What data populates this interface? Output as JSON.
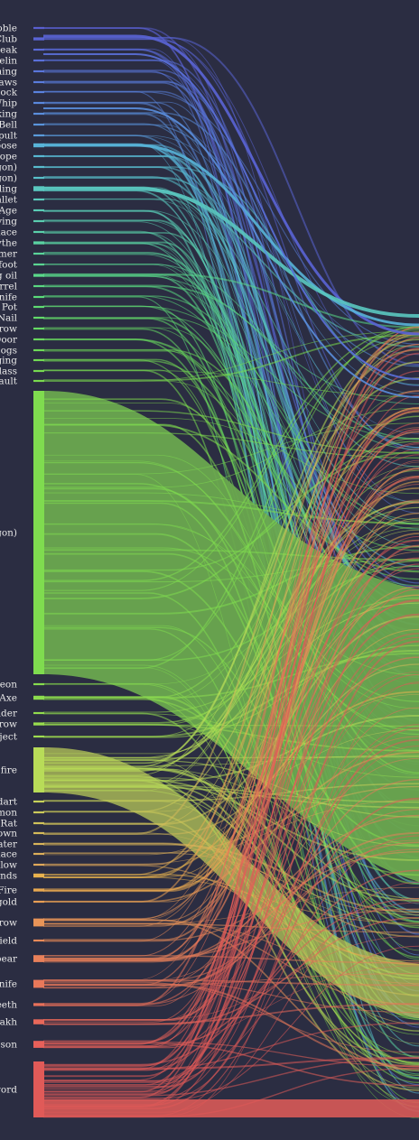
{
  "colors": {
    "background": "#2b2d42",
    "main_flow": "#6aa84f",
    "main_bar": "#7fdc4f"
  },
  "nodes": [
    {
      "label": "oble",
      "color": "#5a5fd0",
      "weight": 1
    },
    {
      "label": "Club",
      "color": "#5a64d6",
      "weight": 1.5
    },
    {
      "label": "eak",
      "color": "#5a6ad8",
      "weight": 1
    },
    {
      "label": "elin",
      "color": "#5a70da",
      "weight": 1
    },
    {
      "label": "ning",
      "color": "#5a76dc",
      "weight": 1
    },
    {
      "label": "aws",
      "color": "#5a7cdd",
      "weight": 1
    },
    {
      "label": "ock",
      "color": "#5a82de",
      "weight": 1
    },
    {
      "label": "Whip",
      "color": "#5a88de",
      "weight": 1
    },
    {
      "label": "king",
      "color": "#5a8edd",
      "weight": 1
    },
    {
      "label": "Bell",
      "color": "#5a94dc",
      "weight": 1
    },
    {
      "label": "pult",
      "color": "#5a9bda",
      "weight": 1
    },
    {
      "label": "oose",
      "color": "#58b4d8",
      "weight": 2
    },
    {
      "label": "ope",
      "color": "#58b8d2",
      "weight": 1
    },
    {
      "label": "gon)",
      "color": "#58bcce",
      "weight": 1
    },
    {
      "label": "gon)",
      "color": "#58c0ca",
      "weight": 1
    },
    {
      "label": "ling",
      "color": "#5ac8c0",
      "weight": 2.5
    },
    {
      "label": "allet",
      "color": "#5acabc",
      "weight": 1
    },
    {
      "label": "Age",
      "color": "#5accb6",
      "weight": 1
    },
    {
      "label": "ying",
      "color": "#5aceb0",
      "weight": 1
    },
    {
      "label": "lace",
      "color": "#5ad0aa",
      "weight": 1
    },
    {
      "label": "ythe",
      "color": "#5ad2a2",
      "weight": 1.5
    },
    {
      "label": "mer",
      "color": "#5ad49a",
      "weight": 1
    },
    {
      "label": "foot",
      "color": "#5ad692",
      "weight": 1
    },
    {
      "label": "g oil",
      "color": "#5ad88a",
      "weight": 1.5
    },
    {
      "label": "rrel",
      "color": "#5ad882",
      "weight": 1
    },
    {
      "label": "nife",
      "color": "#5ada7a",
      "weight": 1
    },
    {
      "label": "Pot",
      "color": "#5eda72",
      "weight": 1
    },
    {
      "label": "Nail",
      "color": "#62da6a",
      "weight": 1
    },
    {
      "label": "row",
      "color": "#66da64",
      "weight": 1
    },
    {
      "label": "Door",
      "color": "#6ada5e",
      "weight": 1
    },
    {
      "label": "ogs",
      "color": "#6eda58",
      "weight": 1
    },
    {
      "label": "ging",
      "color": "#72da54",
      "weight": 1
    },
    {
      "label": "lass",
      "color": "#76da50",
      "weight": 1
    },
    {
      "label": "ault",
      "color": "#7ada4e",
      "weight": 1
    },
    {
      "label": "gon)",
      "color": "#7fdc4f",
      "weight": 60,
      "main": true
    },
    {
      "label": "eon",
      "color": "#86dc4e",
      "weight": 1
    },
    {
      "label": "Axe",
      "color": "#8cdc4e",
      "weight": 2
    },
    {
      "label": "lder",
      "color": "#92dc4e",
      "weight": 1
    },
    {
      "label": "row",
      "color": "#98dc4e",
      "weight": 1.5
    },
    {
      "label": "ject",
      "color": "#9edc50",
      "weight": 1
    },
    {
      "label": "fire",
      "color": "#b8dc58",
      "weight": 10
    },
    {
      "label": "dart",
      "color": "#c8d25a",
      "weight": 1
    },
    {
      "label": "mon",
      "color": "#ccca5a",
      "weight": 1
    },
    {
      "label": "Rat",
      "color": "#d0c25a",
      "weight": 1
    },
    {
      "label": "own",
      "color": "#d4ba5a",
      "weight": 1
    },
    {
      "label": "ater",
      "color": "#d8b45a",
      "weight": 1
    },
    {
      "label": "lace",
      "color": "#dcae5a",
      "weight": 1
    },
    {
      "label": "llow",
      "color": "#e0a85a",
      "weight": 1
    },
    {
      "label": "ands",
      "color": "#e8b24e",
      "weight": 2
    },
    {
      "label": "Fire",
      "color": "#e8a850",
      "weight": 1.5
    },
    {
      "label": "gold",
      "color": "#e89e54",
      "weight": 1
    },
    {
      "label": "row",
      "color": "#e89458",
      "weight": 4
    },
    {
      "label": "ield",
      "color": "#e88a58",
      "weight": 1
    },
    {
      "label": "pear",
      "color": "#e8805a",
      "weight": 3.5
    },
    {
      "label": "nife",
      "color": "#e8785a",
      "weight": 4
    },
    {
      "label": "eeth",
      "color": "#e8705a",
      "weight": 1.5
    },
    {
      "label": "akh",
      "color": "#e8685a",
      "weight": 2.5
    },
    {
      "label": "son",
      "color": "#e8605a",
      "weight": 3.5
    },
    {
      "label": "word",
      "color": "#e05a58",
      "weight": 12
    }
  ],
  "target_band": {
    "label": "",
    "colors": [
      "#5a64d6",
      "#58b4d8",
      "#e86a5a",
      "#e05a58"
    ]
  }
}
